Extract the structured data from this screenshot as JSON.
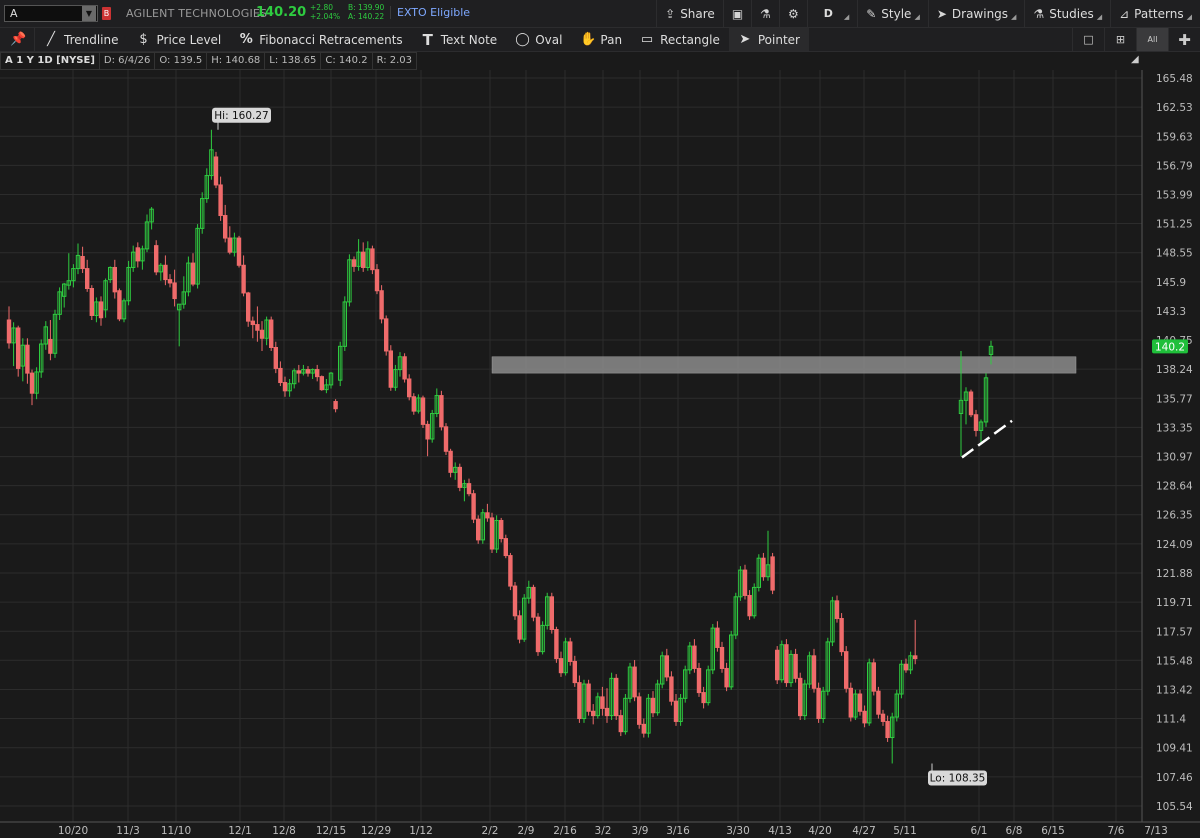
{
  "header": {
    "symbol": "A",
    "symbol_flag": "B",
    "company": "AGILENT TECHNOLOGIES",
    "last": "140.20",
    "change": "+2.80",
    "change_pct": "+2.04%",
    "bid": "B: 139.90",
    "ask": "A: 140.22",
    "exto": "EXTO Eligible",
    "share_label": "Share",
    "period_label": "D",
    "style_label": "Style",
    "drawings_label": "Drawings",
    "studies_label": "Studies",
    "patterns_label": "Patterns"
  },
  "toolbar": {
    "trendline": "Trendline",
    "price_level": "Price Level",
    "fibonacci": "Fibonacci Retracements",
    "text_note": "Text Note",
    "oval": "Oval",
    "pan": "Pan",
    "rectangle": "Rectangle",
    "pointer": "Pointer",
    "view_all": "All"
  },
  "info": {
    "symbol_label": "A 1 Y 1D [NYSE]",
    "date": "D: 6/4/26",
    "open": "O: 139.5",
    "high": "H: 140.68",
    "low": "L: 138.65",
    "close": "C: 140.2",
    "range": "R: 2.03"
  },
  "colors": {
    "up": "#2ecc40",
    "down": "#ef6b6b",
    "grid": "#2c2c2c",
    "background": "#1a1a1a",
    "zone": "#8c8c8c"
  },
  "chart_data": {
    "type": "candlestick",
    "y_ticks": [
      165.48,
      162.53,
      159.63,
      156.79,
      153.99,
      151.25,
      148.55,
      145.9,
      143.3,
      140.75,
      138.24,
      135.77,
      133.35,
      130.97,
      128.64,
      126.35,
      124.09,
      121.88,
      119.71,
      117.57,
      115.48,
      113.42,
      111.4,
      109.41,
      107.46,
      105.54
    ],
    "x_ticks": [
      "10/20",
      "11/3",
      "11/10",
      "12/1",
      "12/8",
      "12/15",
      "12/29",
      "1/12",
      "2/2",
      "2/9",
      "2/16",
      "3/2",
      "3/9",
      "3/16",
      "3/30",
      "4/13",
      "4/20",
      "4/27",
      "5/11",
      "6/1",
      "6/8",
      "6/15",
      "7/6",
      "7/13"
    ],
    "last_price_label": "140.2",
    "hi_label": "Hi: 160.27",
    "lo_label": "Lo: 108.35",
    "ylim": [
      104.8,
      167.0
    ],
    "scale": "log",
    "grid": true,
    "candles": [
      [
        142.5,
        143.7,
        140,
        140.5
      ],
      [
        140.5,
        142.3,
        138.5,
        141.8
      ],
      [
        141.8,
        142,
        137.6,
        138.3
      ],
      [
        138.5,
        140.9,
        137.2,
        140.3
      ],
      [
        140.3,
        140.9,
        137,
        137.9
      ],
      [
        137.9,
        138.2,
        135.2,
        136.2
      ],
      [
        136.2,
        138.4,
        135.7,
        138
      ],
      [
        138,
        140.8,
        137.5,
        140.4
      ],
      [
        140.4,
        142.4,
        139.9,
        141.9
      ],
      [
        140.8,
        142.5,
        139,
        139.6
      ],
      [
        139.6,
        143.4,
        139.2,
        143
      ],
      [
        143,
        145.4,
        142.5,
        145
      ],
      [
        144.6,
        145.8,
        143.6,
        145.7
      ],
      [
        145.6,
        148.5,
        145.2,
        146
      ],
      [
        146,
        147.5,
        145.4,
        147.1
      ],
      [
        147.1,
        149.4,
        146.6,
        148.3
      ],
      [
        148.2,
        149.1,
        146.7,
        147.1
      ],
      [
        147.1,
        147.9,
        145,
        145.3
      ],
      [
        145.3,
        145.6,
        142.5,
        142.9
      ],
      [
        142.9,
        144.5,
        142.3,
        144.1
      ],
      [
        144.1,
        144.6,
        142,
        142.7
      ],
      [
        143.4,
        146.2,
        142.7,
        146
      ],
      [
        146.1,
        147.3,
        145.8,
        147.2
      ],
      [
        147.2,
        147.9,
        144.4,
        145
      ],
      [
        145.1,
        145.3,
        142.4,
        142.6
      ],
      [
        142.6,
        144.4,
        142.3,
        144.2
      ],
      [
        144.2,
        147.8,
        143.8,
        147.2
      ],
      [
        147.2,
        149.2,
        146.8,
        148.6
      ],
      [
        149,
        149.5,
        147.2,
        147.8
      ],
      [
        147.8,
        149.2,
        147,
        148.9
      ],
      [
        148.9,
        152.1,
        148.6,
        151.4
      ],
      [
        151.4,
        152.8,
        150.7,
        152.6
      ],
      [
        149.2,
        149.7,
        146.5,
        146.8
      ],
      [
        146.8,
        147.6,
        146,
        147.4
      ],
      [
        147.4,
        148.3,
        145.6,
        146.1
      ],
      [
        146.1,
        146.6,
        145.4,
        145.8
      ],
      [
        145.8,
        147,
        143.7,
        144.4
      ],
      [
        143.4,
        143.9,
        140.2,
        143.9
      ],
      [
        143.9,
        146.4,
        143.5,
        145
      ],
      [
        145,
        148.2,
        144.6,
        147.6
      ],
      [
        147.6,
        148.5,
        145.5,
        145.7
      ],
      [
        145.7,
        151.2,
        145.3,
        150.8
      ],
      [
        150.8,
        154.2,
        150.3,
        153.6
      ],
      [
        153.6,
        156.5,
        153.2,
        155.8
      ],
      [
        155.8,
        160.27,
        155.4,
        158.3
      ],
      [
        157.6,
        158.1,
        154.6,
        154.9
      ],
      [
        154.9,
        155.7,
        151.5,
        152
      ],
      [
        152,
        153,
        149.5,
        149.9
      ],
      [
        149.9,
        151,
        148.4,
        148.6
      ],
      [
        148.6,
        150.4,
        148.2,
        149.9
      ],
      [
        149.9,
        150.1,
        147.2,
        147.4
      ],
      [
        147.4,
        148.3,
        144.6,
        144.9
      ],
      [
        144.9,
        145,
        141.9,
        142.4
      ],
      [
        142.4,
        142.8,
        140.9,
        142.1
      ],
      [
        142.1,
        143.7,
        140.6,
        141.6
      ],
      [
        141.6,
        142.4,
        139.8,
        140.9
      ],
      [
        140.9,
        142.8,
        140.3,
        142.5
      ],
      [
        142.5,
        142.8,
        139.8,
        140.1
      ],
      [
        140.1,
        140.6,
        137.9,
        138.3
      ],
      [
        138.3,
        138.9,
        136.8,
        137.1
      ],
      [
        137.1,
        137.6,
        135.9,
        136.4
      ],
      [
        136.4,
        137.4,
        135.9,
        137
      ],
      [
        137,
        138.3,
        136.6,
        138.1
      ],
      [
        138.1,
        138.6,
        137.1,
        137.9
      ],
      [
        137.9,
        138.6,
        137.7,
        138.2
      ],
      [
        138.2,
        138.5,
        137.6,
        137.9
      ],
      [
        137.9,
        138.3,
        137.4,
        138.2
      ],
      [
        138.2,
        138.6,
        137.2,
        137.6
      ],
      [
        137.6,
        137.7,
        136.4,
        136.5
      ],
      [
        136.5,
        137.4,
        136.2,
        136.9
      ],
      [
        136.9,
        138,
        136.6,
        137.9
      ],
      [
        135.5,
        135.7,
        134.6,
        134.9
      ],
      [
        137.3,
        140.6,
        136.8,
        140.2
      ],
      [
        140.2,
        144.6,
        139.8,
        144.1
      ],
      [
        144.1,
        148.4,
        143.7,
        147.9
      ],
      [
        147.9,
        148.2,
        146.8,
        147.3
      ],
      [
        147.3,
        149.8,
        146.9,
        148.6
      ],
      [
        148.6,
        149.5,
        146.8,
        147.2
      ],
      [
        147.2,
        149.6,
        146.9,
        148.9
      ],
      [
        148.9,
        149.2,
        146.6,
        147
      ],
      [
        147,
        147.5,
        144.8,
        145.1
      ],
      [
        145.1,
        145.6,
        142.2,
        142.6
      ],
      [
        142.6,
        142.9,
        139.4,
        139.8
      ],
      [
        139.8,
        140.3,
        136.4,
        136.7
      ],
      [
        136.7,
        138.6,
        136.4,
        138.2
      ],
      [
        138.2,
        139.7,
        137.6,
        139.3
      ],
      [
        139.3,
        139.6,
        137.1,
        137.4
      ],
      [
        137.4,
        137.8,
        135.6,
        135.9
      ],
      [
        135.9,
        136.2,
        134.4,
        134.7
      ],
      [
        134.7,
        136.1,
        134.5,
        135.8
      ],
      [
        135.8,
        136,
        133.3,
        133.6
      ],
      [
        133.6,
        133.9,
        131,
        132.4
      ],
      [
        132.4,
        134.8,
        132.1,
        134.5
      ],
      [
        134.5,
        136.6,
        134.2,
        136
      ],
      [
        136,
        136.4,
        133.1,
        133.4
      ],
      [
        133.4,
        133.7,
        131.1,
        131.4
      ],
      [
        131.4,
        131.6,
        129.3,
        129.7
      ],
      [
        129.7,
        130.5,
        129.1,
        130.1
      ],
      [
        130.1,
        130.4,
        128.2,
        128.5
      ],
      [
        128.5,
        129.1,
        127.4,
        128.8
      ],
      [
        128.8,
        129.2,
        127.8,
        128
      ],
      [
        128,
        128.3,
        125.7,
        126
      ],
      [
        126,
        126.3,
        124.1,
        124.4
      ],
      [
        124.4,
        126.8,
        124.1,
        126.5
      ],
      [
        126.5,
        127.2,
        125.8,
        126.1
      ],
      [
        126.1,
        126.5,
        123.4,
        123.7
      ],
      [
        123.7,
        126.3,
        123.4,
        125.9
      ],
      [
        125.9,
        126.1,
        124.2,
        124.5
      ],
      [
        124.5,
        124.8,
        123,
        123.2
      ],
      [
        123.2,
        123.4,
        120.6,
        120.9
      ],
      [
        120.9,
        121.2,
        118.4,
        118.7
      ],
      [
        118.7,
        119.1,
        116.7,
        117
      ],
      [
        117,
        120.3,
        116.8,
        120
      ],
      [
        120,
        121.3,
        119.6,
        120.8
      ],
      [
        120.8,
        121,
        118.3,
        118.6
      ],
      [
        118.6,
        118.9,
        115.8,
        116.1
      ],
      [
        116.1,
        118.3,
        115.9,
        118
      ],
      [
        118,
        120.4,
        117.7,
        120.1
      ],
      [
        120.1,
        120.4,
        117.4,
        117.7
      ],
      [
        117.7,
        117.9,
        115.3,
        115.6
      ],
      [
        115.6,
        116.1,
        114.3,
        114.6
      ],
      [
        114.6,
        117.1,
        114.4,
        116.8
      ],
      [
        116.8,
        117.1,
        115.1,
        115.4
      ],
      [
        115.4,
        115.8,
        113.6,
        113.9
      ],
      [
        113.9,
        114.4,
        111.1,
        111.4
      ],
      [
        111.4,
        114.1,
        111.1,
        113.8
      ],
      [
        113.8,
        114.1,
        111.6,
        111.9
      ],
      [
        111.9,
        112.4,
        111,
        111.6
      ],
      [
        111.6,
        113.2,
        111.4,
        112.9
      ],
      [
        112.9,
        113.6,
        111.6,
        112.1
      ],
      [
        112.1,
        113.5,
        111.1,
        111.6
      ],
      [
        111.6,
        114.6,
        111.3,
        114.2
      ],
      [
        114.2,
        114.5,
        111.3,
        111.6
      ],
      [
        111.6,
        112,
        110.2,
        110.5
      ],
      [
        110.5,
        113.1,
        110.3,
        112.8
      ],
      [
        112.8,
        115.3,
        112.5,
        115
      ],
      [
        115,
        115.5,
        112.6,
        112.9
      ],
      [
        112.9,
        113.2,
        110.7,
        111
      ],
      [
        111,
        111.4,
        110.1,
        110.4
      ],
      [
        110.4,
        113.1,
        110.1,
        112.8
      ],
      [
        112.8,
        113.3,
        111.5,
        111.8
      ],
      [
        111.8,
        114.1,
        111.6,
        113.8
      ],
      [
        113.8,
        116.1,
        113.5,
        115.8
      ],
      [
        115.8,
        116.3,
        114,
        114.3
      ],
      [
        114.3,
        114.7,
        112.3,
        112.6
      ],
      [
        112.6,
        113.1,
        110.9,
        111.2
      ],
      [
        111.2,
        113.1,
        110.9,
        112.8
      ],
      [
        112.8,
        115.1,
        112.5,
        114.8
      ],
      [
        114.8,
        116.8,
        114.5,
        116.5
      ],
      [
        116.5,
        117,
        114.6,
        114.9
      ],
      [
        114.9,
        115.3,
        112.9,
        113.2
      ],
      [
        113.2,
        113.6,
        112.1,
        112.5
      ],
      [
        112.5,
        115.1,
        112.3,
        114.8
      ],
      [
        114.8,
        118.1,
        114.5,
        117.8
      ],
      [
        117.8,
        118.3,
        116.1,
        116.4
      ],
      [
        116.4,
        116.8,
        114.6,
        114.9
      ],
      [
        114.9,
        115.3,
        113.3,
        113.6
      ],
      [
        113.6,
        117.6,
        113.4,
        117.3
      ],
      [
        117.3,
        120.4,
        117,
        120.1
      ],
      [
        120.1,
        122.4,
        119.8,
        122.1
      ],
      [
        122.1,
        122.5,
        119.9,
        120.2
      ],
      [
        120.2,
        120.6,
        118.4,
        118.7
      ],
      [
        118.7,
        121.1,
        118.5,
        120.8
      ],
      [
        120.8,
        123.3,
        120.5,
        123
      ],
      [
        123,
        123.4,
        121.3,
        121.6
      ],
      [
        121.6,
        125.1,
        121.3,
        122.5
      ],
      [
        123.1,
        123.4,
        120.3,
        120.6
      ],
      [
        116.2,
        116.5,
        113.8,
        114.1
      ],
      [
        114.1,
        116.9,
        113.9,
        116.6
      ],
      [
        116.6,
        117,
        113.6,
        113.9
      ],
      [
        113.9,
        116.2,
        113.6,
        115.9
      ],
      [
        115.9,
        116.3,
        113.9,
        114.2
      ],
      [
        114.2,
        114.6,
        111.3,
        111.6
      ],
      [
        111.6,
        114.1,
        111.3,
        113.8
      ],
      [
        113.8,
        116.1,
        113.5,
        115.8
      ],
      [
        115.8,
        116.3,
        113.2,
        113.5
      ],
      [
        113.5,
        113.9,
        111.1,
        111.4
      ],
      [
        111.4,
        113.6,
        111.1,
        113.3
      ],
      [
        113.3,
        117.1,
        113,
        116.8
      ],
      [
        116.8,
        120.1,
        116.5,
        119.8
      ],
      [
        119.8,
        120.2,
        118.2,
        118.5
      ],
      [
        118.5,
        118.9,
        115.8,
        116.1
      ],
      [
        116.1,
        116.5,
        113.2,
        113.5
      ],
      [
        113.5,
        113.9,
        111.2,
        111.5
      ],
      [
        111.5,
        113.4,
        111.3,
        113.1
      ],
      [
        113.1,
        113.4,
        111.6,
        111.9
      ],
      [
        111.9,
        112.3,
        110.8,
        111.1
      ],
      [
        111.1,
        115.6,
        110.9,
        115.3
      ],
      [
        115.3,
        115.6,
        113,
        113.3
      ],
      [
        113.3,
        113.6,
        111.4,
        111.7
      ],
      [
        111.7,
        112,
        110.9,
        111.2
      ],
      [
        111.2,
        111.6,
        109.8,
        110.1
      ],
      [
        110.1,
        111.8,
        108.35,
        111.5
      ],
      [
        111.5,
        113.4,
        111.2,
        113.1
      ],
      [
        113.1,
        115.5,
        112.8,
        115.2
      ],
      [
        115.2,
        115.6,
        114.6,
        114.8
      ],
      [
        114.8,
        116.1,
        114.5,
        115.8
      ],
      [
        115.8,
        118.4,
        115.2,
        115.6
      ]
    ],
    "recent_candles": [
      [
        134.5,
        139.8,
        131,
        135.6
      ],
      [
        135.6,
        136.7,
        133.6,
        136.3
      ],
      [
        136.3,
        136.5,
        134.2,
        134.4
      ],
      [
        134.4,
        134.8,
        132.6,
        133.1
      ],
      [
        133.1,
        134,
        132,
        133.8
      ],
      [
        133.8,
        137.9,
        133.4,
        137.5
      ],
      [
        139.5,
        140.68,
        138.65,
        140.2
      ]
    ],
    "resistance_zone": [
      137.9,
      139.3
    ],
    "trendline": [
      [
        0.0,
        130.9
      ],
      [
        1.0,
        133.9
      ]
    ]
  }
}
